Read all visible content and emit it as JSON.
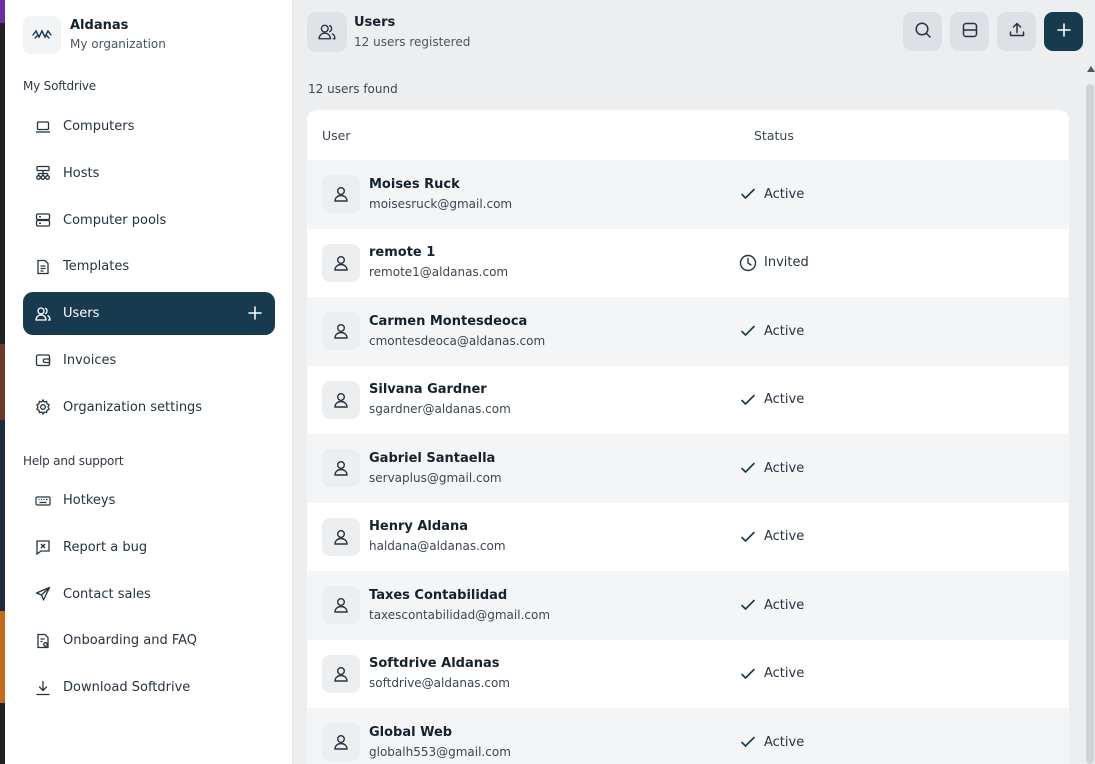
{
  "organization": {
    "name": "Aldanas",
    "subtitle": "My organization"
  },
  "sidebar": {
    "section_main": "My Softdrive",
    "items": [
      {
        "label": "Computers",
        "icon": "laptop-icon"
      },
      {
        "label": "Hosts",
        "icon": "network-icon"
      },
      {
        "label": "Computer pools",
        "icon": "server-icon"
      },
      {
        "label": "Templates",
        "icon": "document-icon"
      },
      {
        "label": "Users",
        "icon": "users-icon",
        "active": true
      },
      {
        "label": "Invoices",
        "icon": "wallet-icon"
      },
      {
        "label": "Organization settings",
        "icon": "gear-icon"
      }
    ],
    "section_help": "Help and support",
    "help_items": [
      {
        "label": "Hotkeys",
        "icon": "keyboard-icon"
      },
      {
        "label": "Report a bug",
        "icon": "bug-report-icon"
      },
      {
        "label": "Contact sales",
        "icon": "send-icon"
      },
      {
        "label": "Onboarding and FAQ",
        "icon": "faq-icon"
      },
      {
        "label": "Download Softdrive",
        "icon": "download-icon"
      }
    ]
  },
  "header": {
    "title": "Users",
    "subtitle": "12 users registered"
  },
  "toolbar": {
    "icons": [
      "search-icon",
      "layout-icon",
      "upload-icon",
      "plus-icon"
    ]
  },
  "results_count": "12 users found",
  "table": {
    "columns": {
      "user": "User",
      "status": "Status"
    },
    "rows": [
      {
        "name": "Moises Ruck",
        "email": "moisesruck@gmail.com",
        "status": "Active"
      },
      {
        "name": "remote 1",
        "email": "remote1@aldanas.com",
        "status": "Invited"
      },
      {
        "name": "Carmen Montesdeoca",
        "email": "cmontesdeoca@aldanas.com",
        "status": "Active"
      },
      {
        "name": "Silvana Gardner",
        "email": "sgardner@aldanas.com",
        "status": "Active"
      },
      {
        "name": "Gabriel Santaella",
        "email": "servaplus@gmail.com",
        "status": "Active"
      },
      {
        "name": "Henry Aldana",
        "email": "haldana@aldanas.com",
        "status": "Active"
      },
      {
        "name": "Taxes Contabilidad",
        "email": "taxescontabilidad@gmail.com",
        "status": "Active"
      },
      {
        "name": "Softdrive Aldanas",
        "email": "softdrive@aldanas.com",
        "status": "Active"
      },
      {
        "name": "Global Web",
        "email": "globalh553@gmail.com",
        "status": "Active"
      }
    ]
  },
  "colors": {
    "accent": "#173a4f",
    "page_bg": "#eceef0"
  }
}
